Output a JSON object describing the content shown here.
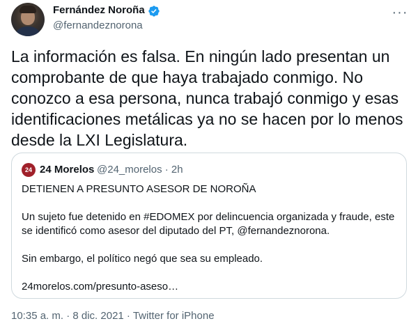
{
  "author": {
    "display_name": "Fernández Noroña",
    "handle": "@fernandeznorona",
    "verified": true,
    "avatar_icon": "profile-photo"
  },
  "more_icon": "more-options-icon",
  "tweet": {
    "text": "La información es falsa. En ningún lado presentan un\ncomprobante de que haya trabajado conmigo. No\nconozco a esa persona, nunca trabajó conmigo y esas\nidentificaciones metálicas ya no se hacen por lo menos\ndesde la LXI Legislatura."
  },
  "quoted": {
    "avatar_label": "24",
    "name": "24 Morelos",
    "meta": "@24_morelos · 2h",
    "headline": "DETIENEN A PRESUNTO ASESOR DE NOROÑA",
    "body": "Un sujeto fue detenido en #EDOMEX por delincuencia organizada y fraude, este se identificó como asesor del diputado del PT, @fernandeznorona.",
    "body2": "Sin embargo, el político negó que sea su empleado.",
    "link": "24morelos.com/presunto-aseso…"
  },
  "footer": {
    "timestamp": "10:35 a. m. · 8 dic. 2021 · Twitter for iPhone"
  },
  "colors": {
    "text": "#0f1419",
    "secondary": "#536471",
    "verified": "#1d9bf0",
    "border": "#cfd9de",
    "quote_avatar": "#a0202a"
  }
}
